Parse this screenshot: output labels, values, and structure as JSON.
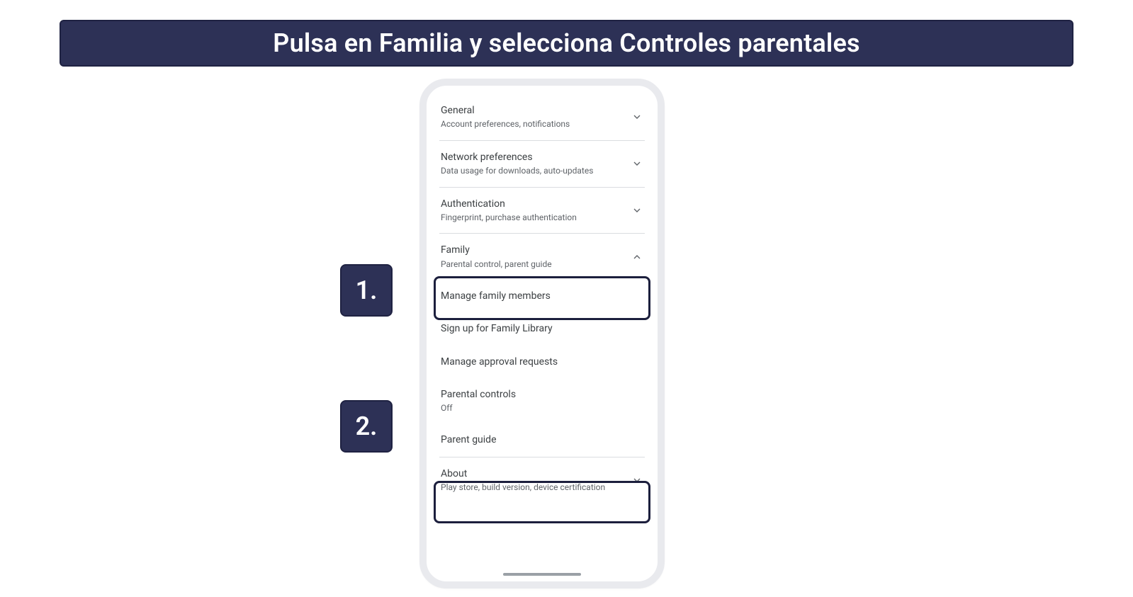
{
  "banner": {
    "title": "Pulsa en Familia y selecciona Controles parentales"
  },
  "steps": {
    "one": "1.",
    "two": "2."
  },
  "settings": {
    "general": {
      "title": "General",
      "sub": "Account preferences, notifications"
    },
    "network": {
      "title": "Network preferences",
      "sub": "Data usage for downloads, auto-updates"
    },
    "auth": {
      "title": "Authentication",
      "sub": "Fingerprint, purchase authentication"
    },
    "family": {
      "title": "Family",
      "sub": "Parental control, parent guide"
    },
    "manage_members": {
      "title": "Manage family members"
    },
    "family_library": {
      "title": "Sign up for Family Library"
    },
    "approval": {
      "title": "Manage approval requests"
    },
    "parental": {
      "title": "Parental controls",
      "sub": "Off"
    },
    "parent_guide": {
      "title": "Parent guide"
    },
    "about": {
      "title": "About",
      "sub": "Play store, build version, device certification"
    }
  }
}
